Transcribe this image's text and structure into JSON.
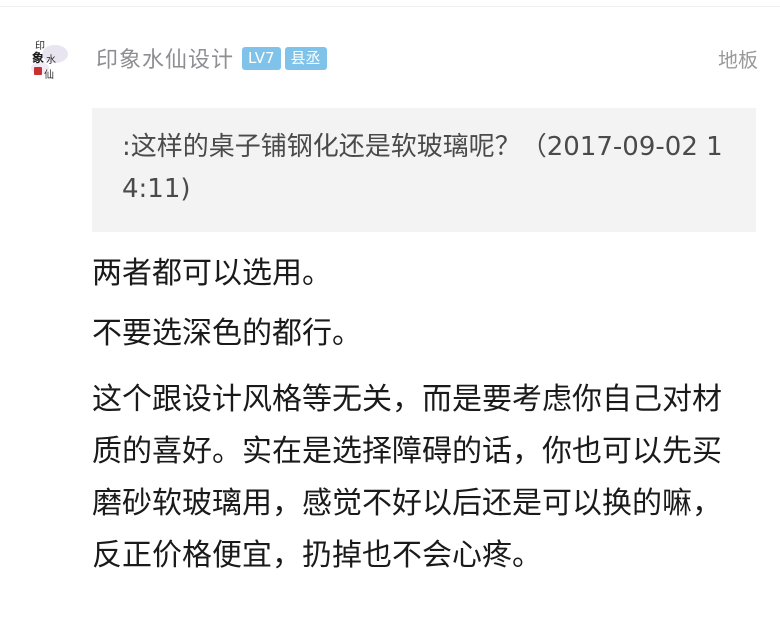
{
  "post": {
    "username": "印象水仙设计",
    "level_badge": "LV7",
    "rank_badge": "县丞",
    "floor_label": "地板",
    "avatar_text": "印象水仙",
    "quote": ":这样的桌子铺钢化还是软玻璃呢？（2017-09-02 14:11)",
    "paragraphs": [
      "两者都可以选用。",
      "不要选深色的都行。",
      "这个跟设计风格等无关，而是要考虑你自己对材质的喜好。实在是选择障碍的话，你也可以先买磨砂软玻璃用，感觉不好以后还是可以换的嘛，反正价格便宜，扔掉也不会心疼。"
    ]
  },
  "colors": {
    "badge_bg": "#7fc3ea",
    "username": "#8e8e93",
    "quote_bg": "#f3f3f3",
    "body_text": "#1a1a1a"
  },
  "icons": {
    "avatar": "calligraphy-avatar-icon"
  }
}
